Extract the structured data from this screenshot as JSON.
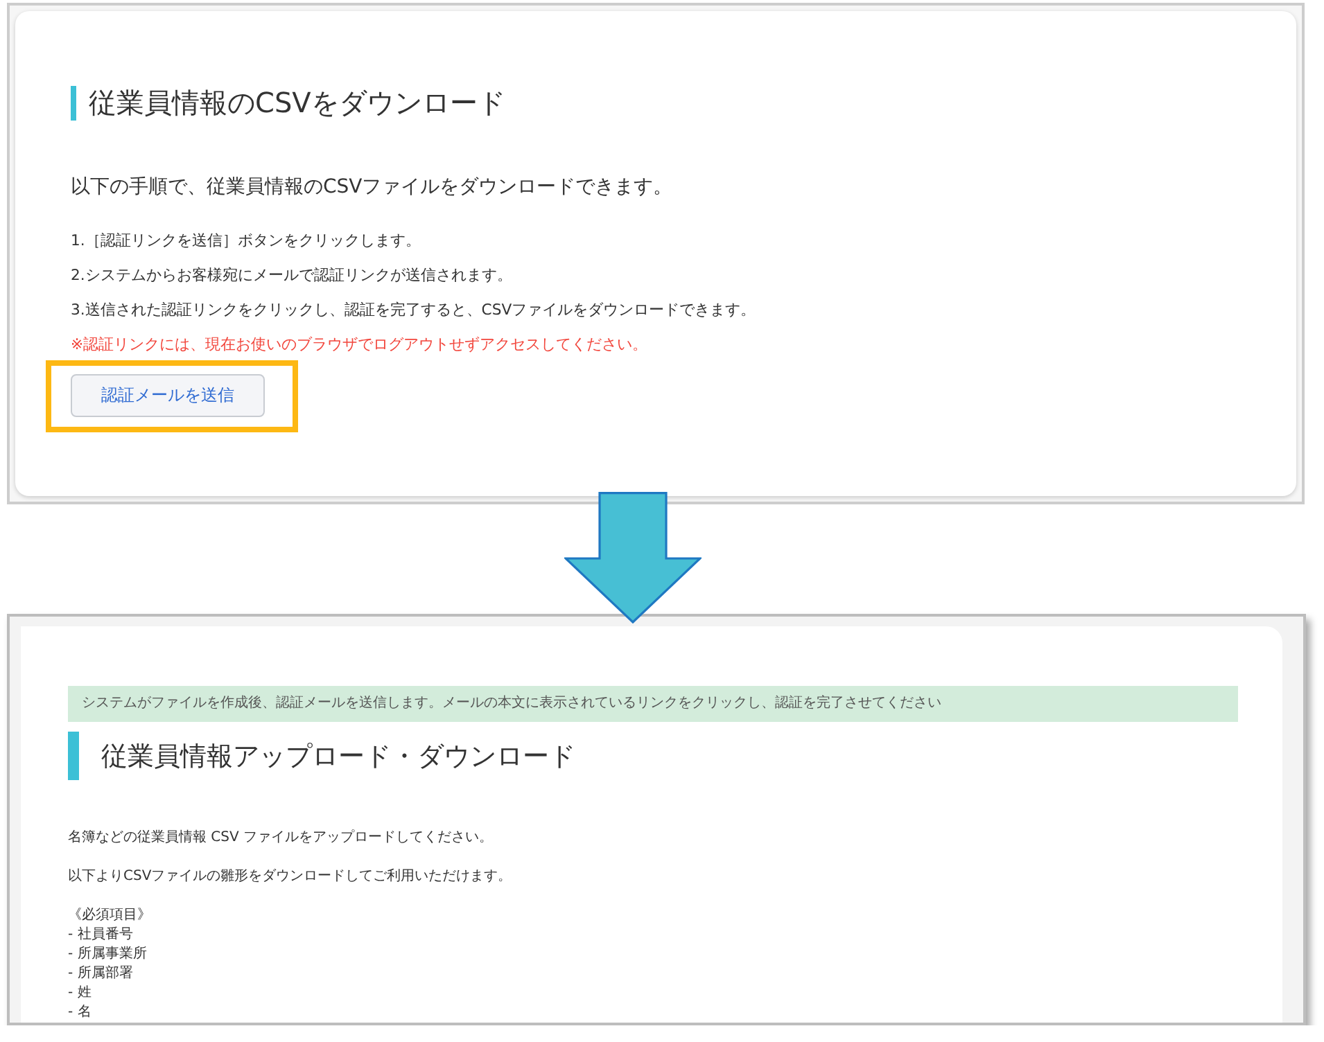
{
  "before_screen": {
    "heading": "従業員情報のCSVをダウンロード",
    "intro": "以下の手順で、従業員情報のCSVファイルをダウンロードできます。",
    "steps": [
      "1.［認証リンクを送信］ボタンをクリックします。",
      "2.システムからお客様宛にメールで認証リンクが送信されます。",
      "3.送信された認証リンクをクリックし、認証を完了すると、CSVファイルをダウンロードできます。"
    ],
    "notice": "※認証リンクには、現在お使いのブラウザでログアウトせずアクセスしてください。",
    "send_button": {
      "label": "認証メールを送信",
      "highlighted": true
    }
  },
  "after_screen": {
    "banner": "システムがファイルを作成後、認証メールを送信します。メールの本文に表示されているリンクをクリックし、認証を完了させてください",
    "heading": "従業員情報アップロード・ダウンロード",
    "paragraphs": [
      "名簿などの従業員情報 CSV ファイルをアップロードしてください。",
      "以下よりCSVファイルの雛形をダウンロードしてご利用いただけます。"
    ],
    "required_heading": "《必須項目》",
    "required_items": [
      "- 社員番号",
      "- 所属事業所",
      "- 所属部署",
      "- 姓",
      "- 名"
    ]
  }
}
